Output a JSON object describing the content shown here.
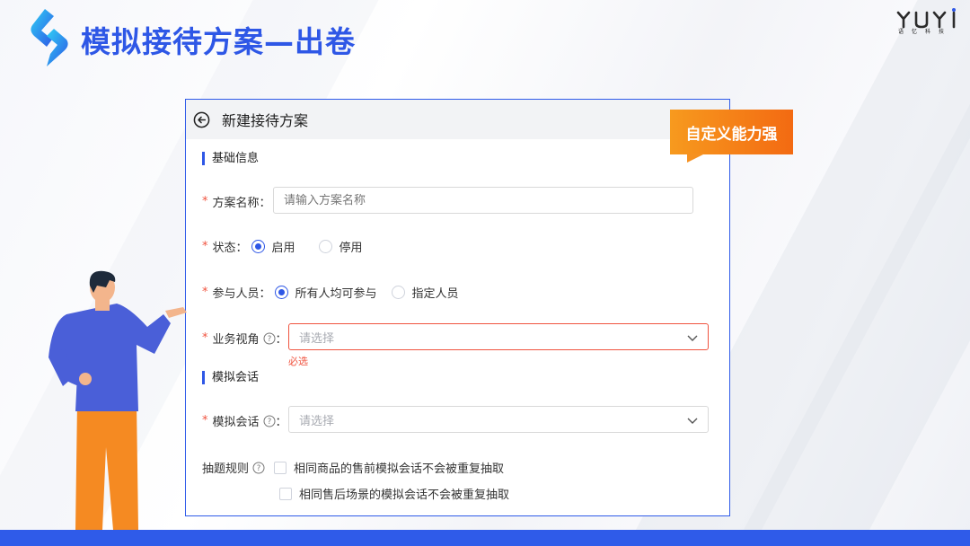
{
  "slide": {
    "title": "模拟接待方案—出卷",
    "brand_name": "YUYI",
    "brand_cn": "语忆科技",
    "accent_color": "#2e57e6",
    "tag_color": "#f36a12"
  },
  "panel": {
    "back_icon": "arrow-left-circle-icon",
    "title": "新建接待方案"
  },
  "basic_section": {
    "label": "基础信息",
    "plan_name": {
      "label": "方案名称：",
      "placeholder": "请输入方案名称"
    },
    "status": {
      "label": "状态：",
      "options": [
        {
          "label": "启用",
          "selected": true
        },
        {
          "label": "停用",
          "selected": false
        }
      ]
    },
    "participants": {
      "label": "参与人员：",
      "options": [
        {
          "label": "所有人均可参与",
          "selected": true
        },
        {
          "label": "指定人员",
          "selected": false
        }
      ]
    },
    "business_view": {
      "label": "业务视角",
      "colon": "：",
      "placeholder": "请选择",
      "error": "必选"
    }
  },
  "sim_section": {
    "label": "模拟会话",
    "sim_session": {
      "label": "模拟会话",
      "colon": "：",
      "placeholder": "请选择"
    },
    "extract_rules": {
      "label": "抽题规则",
      "options": [
        {
          "label": "相同商品的售前模拟会话不会被重复抽取",
          "checked": false
        },
        {
          "label": "相同售后场景的模拟会话不会被重复抽取",
          "checked": false
        }
      ]
    }
  },
  "callout": {
    "text": "自定义能力强"
  }
}
